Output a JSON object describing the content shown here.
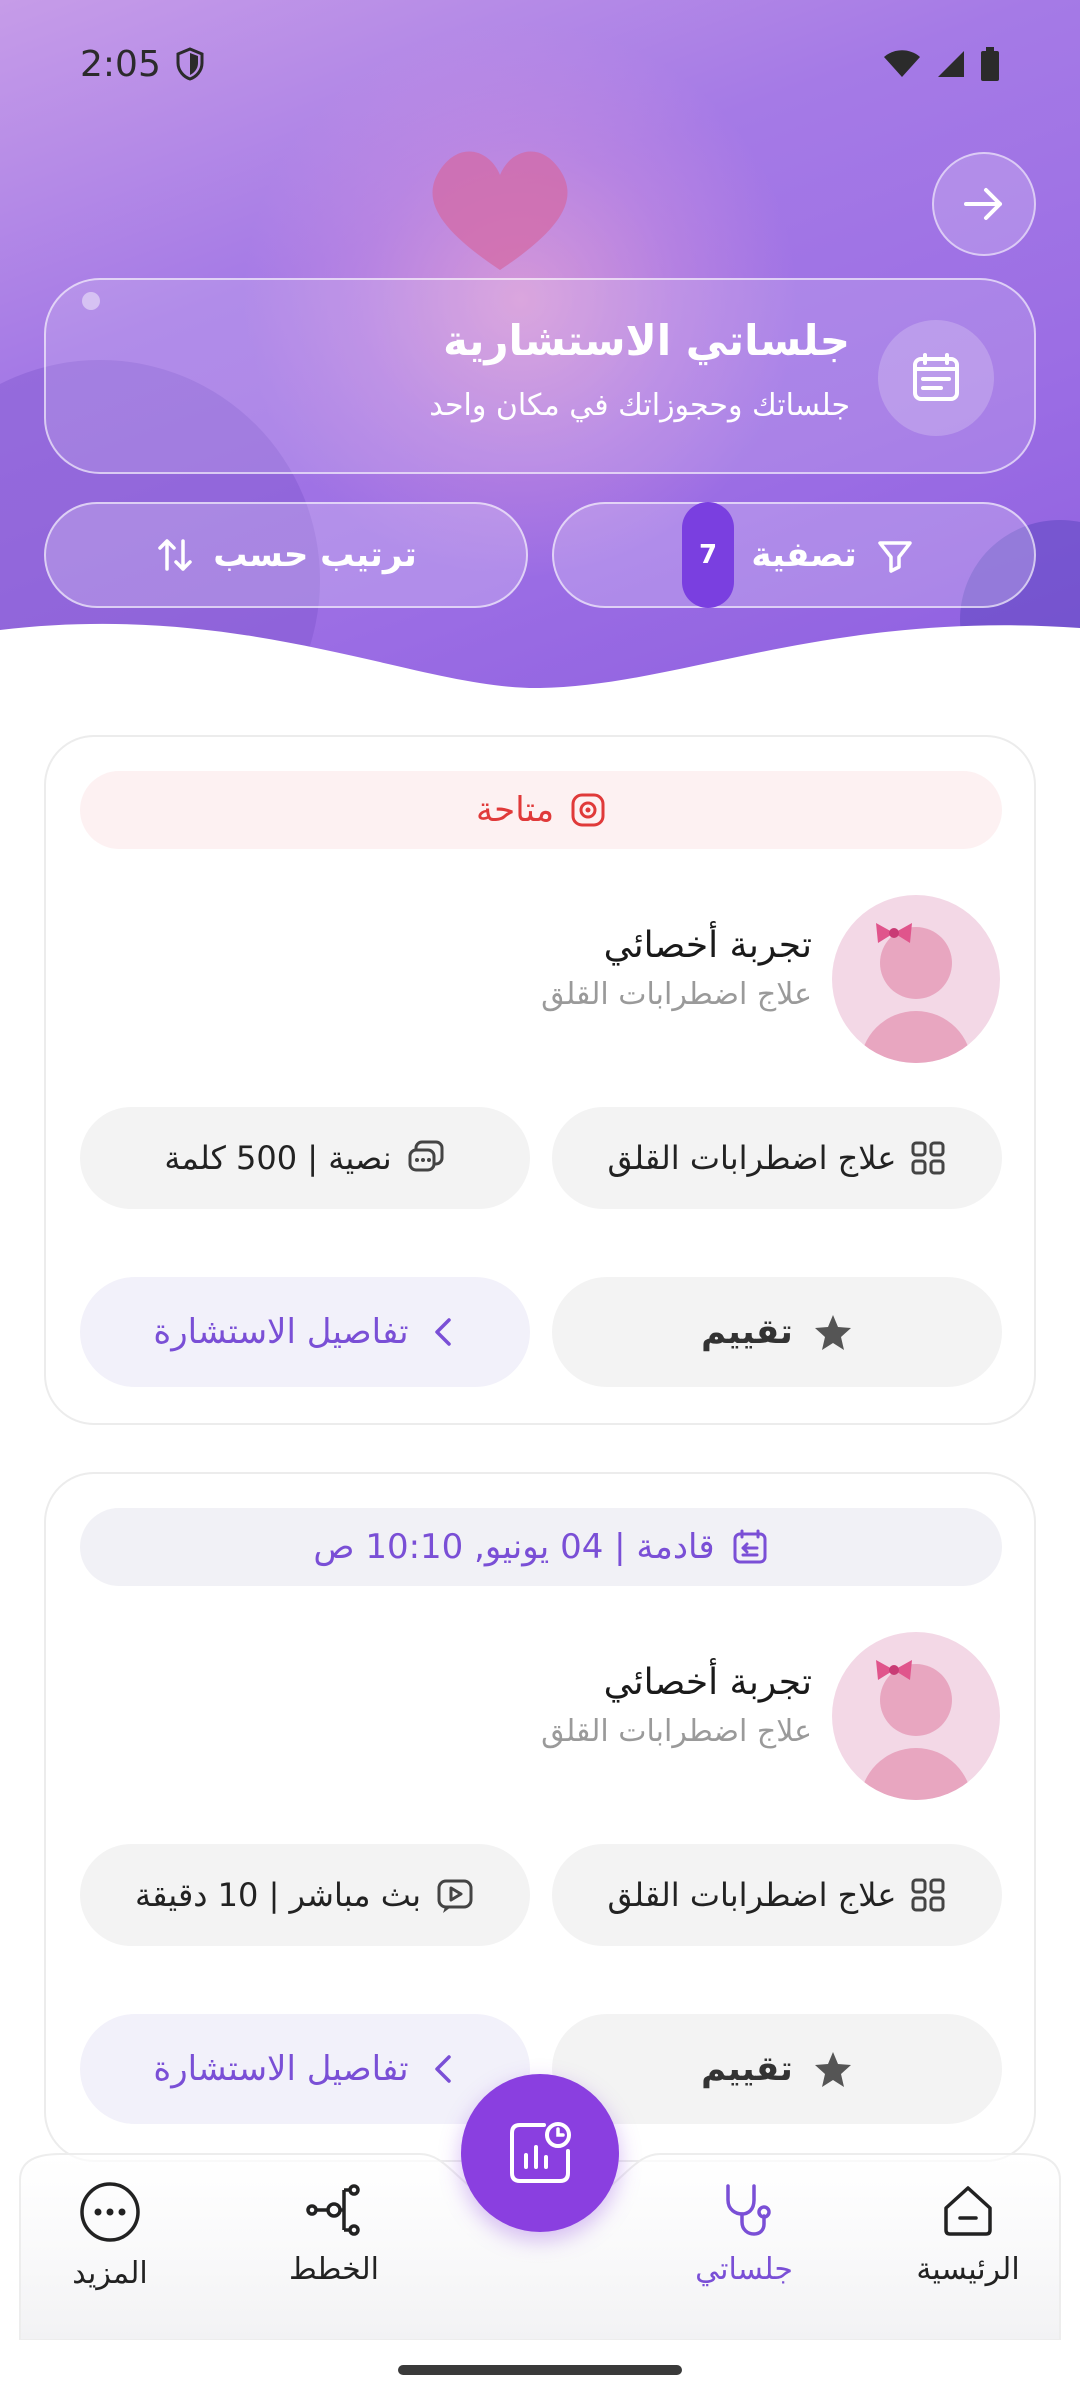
{
  "status_bar": {
    "time": "2:05"
  },
  "header": {
    "title": "جلساتي الاستشارية",
    "subtitle": "جلساتك وحجوزاتك في مكان واحد",
    "filter_label": "تصفية",
    "filter_count": "7",
    "sort_label": "ترتيب حسب"
  },
  "sessions": [
    {
      "status_text": "متاحة",
      "name": "تجربة أخصائي",
      "specialty": "علاج اضطرابات القلق",
      "chip_specialty": "علاج اضطرابات القلق",
      "chip_type": "نصية | 500 كلمة",
      "rate_label": "تقييم",
      "details_label": "تفاصيل الاستشارة"
    },
    {
      "status_text": "قادمة | 04 يونيو, 10:10 ص",
      "name": "تجربة أخصائي",
      "specialty": "علاج اضطرابات القلق",
      "chip_specialty": "علاج اضطرابات القلق",
      "chip_type": "بث مباشر | 10 دقيقة",
      "rate_label": "تقييم",
      "details_label": "تفاصيل الاستشارة"
    }
  ],
  "bottom_nav": {
    "home": "الرئيسية",
    "sessions": "جلساتي",
    "plans": "الخطط",
    "more": "المزيد"
  },
  "colors": {
    "accent": "#7a4fd6",
    "fab": "#8a3fe0",
    "available": "#e03a3a"
  }
}
